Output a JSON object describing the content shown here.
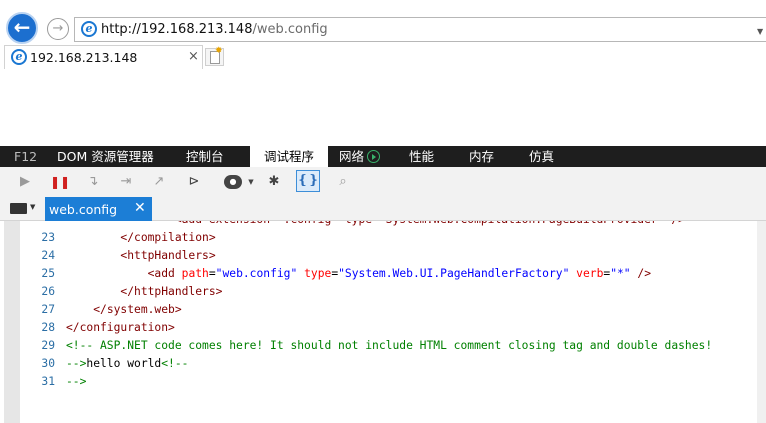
{
  "browser": {
    "url_host": "http://192.168.213.148",
    "url_path": "/web.config",
    "tab_title": "192.168.213.148",
    "tab_close": "×"
  },
  "devtools": {
    "tabs": [
      "F12",
      "DOM 资源管理器",
      "控制台",
      "调试程序",
      "网络",
      "性能",
      "内存",
      "仿真"
    ],
    "active_tab": "调试程序",
    "toolbar_icons": [
      "continue-icon",
      "break-icon",
      "step-into-icon",
      "step-over-icon",
      "step-out-icon",
      "break-on-new-worker-icon",
      "exception-behavior-icon",
      "disconnect-debugger-icon",
      "just-my-code-icon",
      "pretty-print-icon"
    ],
    "file_tab": {
      "name": "web.config",
      "close": "✕"
    }
  },
  "code": {
    "clipped_line": "                <add extension=\".config\" type=\"System.Web.Compilation.PageBuildProvider\" />",
    "lines": [
      {
        "num": "23",
        "text": "        </compilation>"
      },
      {
        "num": "24",
        "text": "        <httpHandlers>"
      },
      {
        "num": "25",
        "text": "            <add path=\"web.config\" type=\"System.Web.UI.PageHandlerFactory\" verb=\"*\" />"
      },
      {
        "num": "26",
        "text": "        </httpHandlers>"
      },
      {
        "num": "27",
        "text": "    </system.web>"
      },
      {
        "num": "28",
        "text": "</configuration>"
      },
      {
        "num": "29",
        "text": "<!-- ASP.NET code comes here! It should not include HTML comment closing tag and double dashes!"
      },
      {
        "num": "30",
        "text": "-->hello world<!--"
      },
      {
        "num": "31",
        "text": "-->"
      }
    ]
  },
  "colors": {
    "accent": "#1c7ed6",
    "devtools_bar": "#1e1e1e",
    "tag": "#800000",
    "attr": "#ff0000",
    "value": "#0000ff",
    "comment": "#008000",
    "line_number": "#2b6ea5"
  }
}
